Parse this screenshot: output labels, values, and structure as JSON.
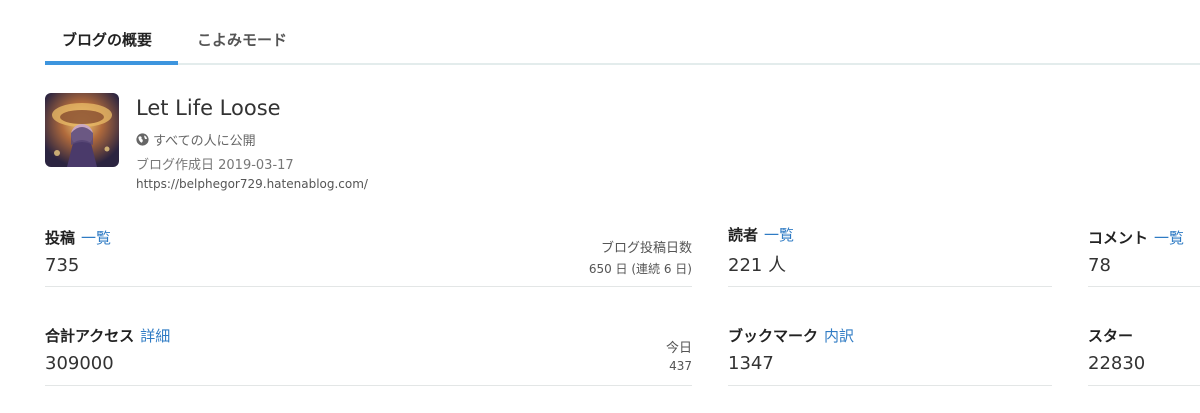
{
  "tabs": [
    {
      "label": "ブログの概要",
      "active": true
    },
    {
      "label": "こよみモード",
      "active": false
    }
  ],
  "blog": {
    "title": "Let Life Loose",
    "visibility": "すべての人に公開",
    "created": "ブログ作成日 2019-03-17",
    "url": "https://belphegor729.hatenablog.com/"
  },
  "stats": {
    "posts": {
      "label": "投稿",
      "link": "一覧",
      "value": "735",
      "side_label": "ブログ投稿日数",
      "side_value": "650 日 (連続 6 日)"
    },
    "readers": {
      "label": "読者",
      "link": "一覧",
      "value": "221 人"
    },
    "comments": {
      "label": "コメント",
      "link": "一覧",
      "value": "78"
    },
    "access": {
      "label": "合計アクセス",
      "link": "詳細",
      "value": "309000",
      "side_label": "今日",
      "side_value": "437"
    },
    "bookmarks": {
      "label": "ブックマーク",
      "link": "内訳",
      "value": "1347"
    },
    "stars": {
      "label": "スター",
      "value": "22830"
    }
  },
  "colors": {
    "accent": "#3d95de",
    "link": "#2f7bc4"
  },
  "icons": {
    "visibility": "globe-icon"
  }
}
